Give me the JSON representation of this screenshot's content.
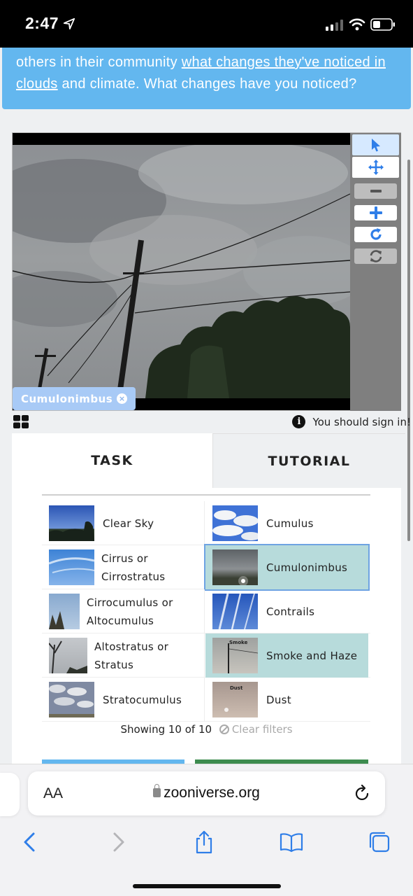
{
  "status_bar": {
    "time": "2:47",
    "icons": [
      "location-arrow-icon",
      "cellular-signal-icon",
      "wifi-icon",
      "battery-icon"
    ]
  },
  "banner": {
    "text_before": "others in their community ",
    "link_text": "what changes they've noticed in clouds",
    "text_after": " and climate. What changes have you noticed?"
  },
  "viewer": {
    "tools": [
      "pointer-icon",
      "move-icon",
      "zoom-out-icon",
      "zoom-in-icon",
      "rotate-icon",
      "reset-icon"
    ],
    "selected_label": "Cumulonimbus"
  },
  "signin_notice": "You should sign in!",
  "tabs": {
    "task": "TASK",
    "tutorial": "TUTORIAL"
  },
  "cloud_types": [
    {
      "left": {
        "name": "Clear Sky"
      },
      "right": {
        "name": "Cumulus"
      }
    },
    {
      "left": {
        "name": "Cirrus or Cirrostratus"
      },
      "right": {
        "name": "Cumulonimbus",
        "selected": true
      }
    },
    {
      "left": {
        "name": "Cirrocumulus or Altocumulus"
      },
      "right": {
        "name": "Contrails"
      }
    },
    {
      "left": {
        "name": "Altostratus or Stratus"
      },
      "right": {
        "name": "Smoke and Haze",
        "selected": true,
        "thumb_label": "Smoke"
      }
    },
    {
      "left": {
        "name": "Stratocumulus"
      },
      "right": {
        "name": "Dust",
        "thumb_label": "Dust"
      }
    }
  ],
  "filter": {
    "showing": "Showing 10 of 10",
    "clear_label": "Clear filters"
  },
  "safari": {
    "aa_label": "AA",
    "url": "zooniverse.org",
    "nav": [
      "back-icon",
      "forward-icon",
      "share-icon",
      "bookmarks-icon",
      "tabs-icon"
    ]
  },
  "colors": {
    "banner": "#63b7ef",
    "selected_bg": "#b7dbdb",
    "label_chip": "#a8caf6",
    "accent_blue": "#2f7ee8"
  }
}
